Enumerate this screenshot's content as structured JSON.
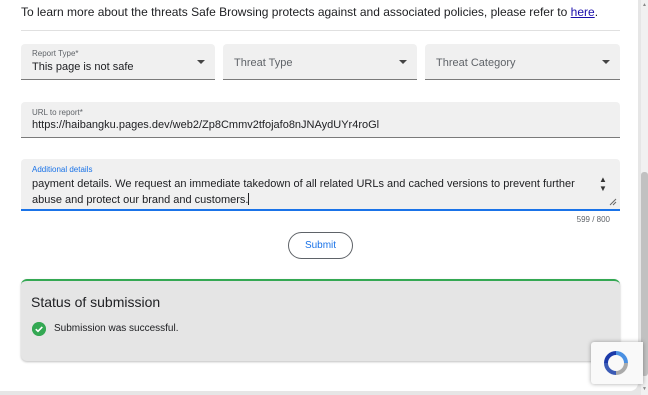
{
  "intro": {
    "text": "To learn more about the threats Safe Browsing protects against and associated policies, please refer to ",
    "link": "here",
    "period": "."
  },
  "form": {
    "report_type": {
      "label": "Report Type*",
      "value": "This page is not safe"
    },
    "threat_type": {
      "placeholder": "Threat Type"
    },
    "threat_category": {
      "placeholder": "Threat Category"
    },
    "url": {
      "label": "URL to report*",
      "value": "https://haibangku.pages.dev/web2/Zp8Cmmv2tfojafo8nJNAydUYr4roGl"
    },
    "details": {
      "label": "Additional details",
      "value": "payment details. We request an immediate takedown of all related URLs and cached versions to prevent further abuse and protect our brand and customers."
    },
    "counter": "599 / 800",
    "submit_label": "Submit"
  },
  "status": {
    "title": "Status of submission",
    "message": "Submission was successful."
  },
  "colors": {
    "accent": "#1a73e8",
    "success": "#34a853",
    "link": "#1a0dab"
  },
  "icons": {
    "check": "check-circle-icon",
    "dropdown": "chevron-down-icon",
    "recaptcha": "recaptcha-logo-icon"
  }
}
